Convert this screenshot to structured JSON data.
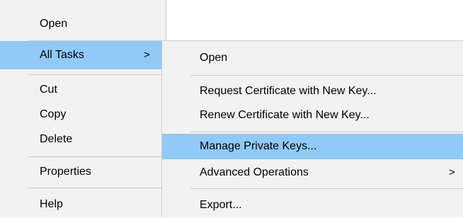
{
  "context_menu": {
    "items": [
      {
        "label": "Open"
      },
      {
        "label": "All Tasks",
        "submenu_indicator": ">",
        "highlighted": true
      },
      {
        "label": "Cut"
      },
      {
        "label": "Copy"
      },
      {
        "label": "Delete"
      },
      {
        "label": "Properties"
      },
      {
        "label": "Help"
      }
    ]
  },
  "submenu": {
    "items": [
      {
        "label": "Open"
      },
      {
        "label": "Request Certificate with New Key..."
      },
      {
        "label": "Renew Certificate with New Key..."
      },
      {
        "label": "Manage Private Keys...",
        "highlighted": true
      },
      {
        "label": "Advanced Operations",
        "submenu_indicator": ">"
      },
      {
        "label": "Export..."
      }
    ]
  },
  "colors": {
    "menu_background": "#f2f2f2",
    "highlight": "#91c9f7",
    "separator": "#cccccc"
  }
}
